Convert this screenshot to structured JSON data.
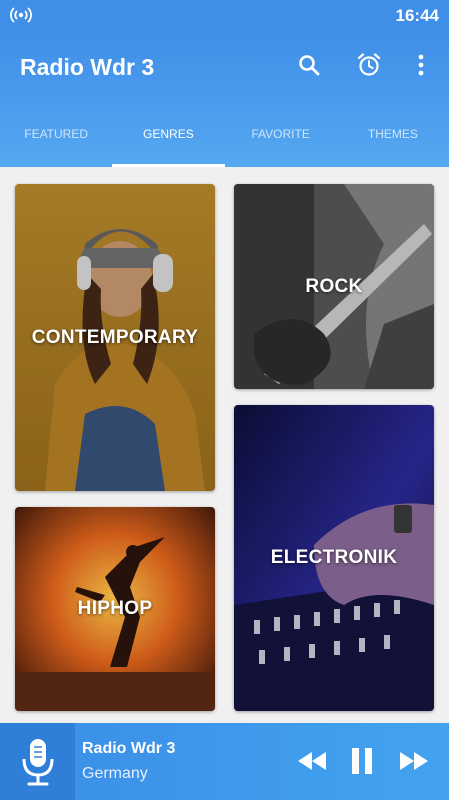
{
  "status_bar": {
    "time": "16:44",
    "left_icon": "radio-signal-icon"
  },
  "app_bar": {
    "title": "Radio Wdr 3",
    "actions": [
      "search-icon",
      "alarm-clock-icon",
      "more-vertical-icon"
    ]
  },
  "tabs": [
    {
      "label": "FEATURED",
      "active": false
    },
    {
      "label": "GENRES",
      "active": true
    },
    {
      "label": "FAVORITE",
      "active": false
    },
    {
      "label": "THEMES",
      "active": false
    }
  ],
  "genres": [
    {
      "label": "CONTEMPORARY"
    },
    {
      "label": "ROCK"
    },
    {
      "label": "HIPHOP"
    },
    {
      "label": "ELECTRONIK"
    }
  ],
  "player": {
    "station": "Radio Wdr 3",
    "country": "Germany",
    "controls": [
      "rewind-icon",
      "pause-icon",
      "fast-forward-icon"
    ]
  },
  "colors": {
    "primary": "#3f8ee8",
    "accent_light": "#55a8f2",
    "player_dark": "#2f7fd9"
  }
}
